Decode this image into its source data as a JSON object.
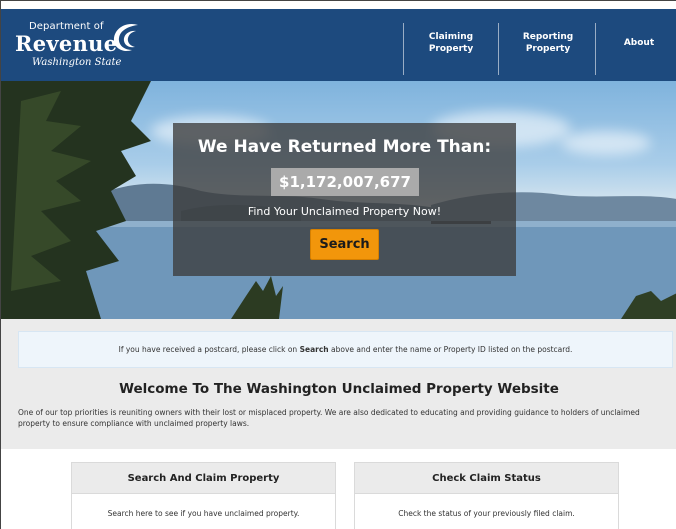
{
  "header": {
    "logo": {
      "line1": "Department of",
      "line2": "Revenue",
      "line3": "Washington State"
    },
    "nav": [
      {
        "label_line1": "Claiming",
        "label_line2": "Property"
      },
      {
        "label_line1": "Reporting",
        "label_line2": "Property"
      },
      {
        "label_line1": "About",
        "label_line2": ""
      }
    ]
  },
  "hero": {
    "title": "We Have Returned More Than:",
    "amount": "$1,172,007,677",
    "subtitle": "Find Your Unclaimed Property Now!",
    "search_button": "Search"
  },
  "notice": {
    "prefix": "If you have received a postcard, please click on ",
    "bold": "Search",
    "suffix": " above and enter the name or Property ID listed on the postcard."
  },
  "welcome": {
    "title": "Welcome To The Washington Unclaimed Property Website",
    "intro": "One of our top priorities is reuniting owners with their lost or misplaced property. We are also dedicated to educating and providing guidance to holders of unclaimed property to ensure compliance with unclaimed property laws."
  },
  "cards": [
    {
      "title": "Search And Claim Property",
      "body": "Search here to see if you have unclaimed property."
    },
    {
      "title": "Check Claim Status",
      "body": "Check the status of your previously filed claim."
    }
  ],
  "colors": {
    "header_bg": "#1d4a7e",
    "accent_button": "#f2960b",
    "content_bg": "#ebebeb"
  }
}
